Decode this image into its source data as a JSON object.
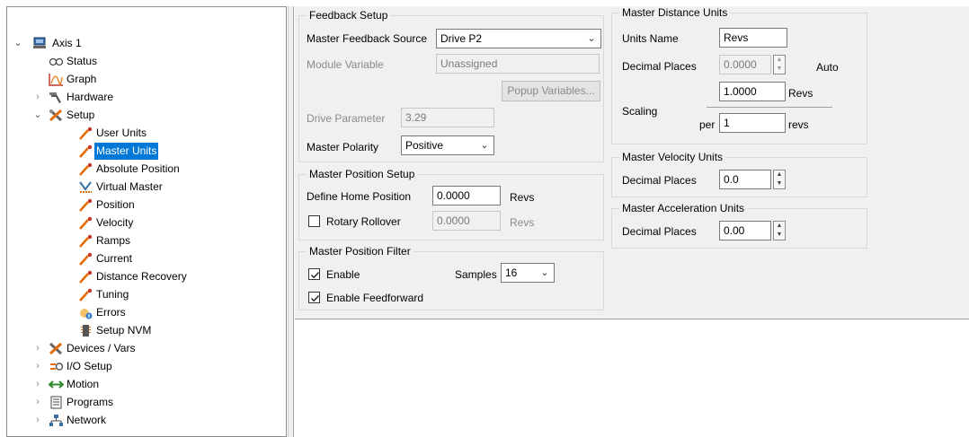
{
  "tree": {
    "items": [
      {
        "label": "Axis 1",
        "icon": "axis-icon",
        "expander": "expanded"
      },
      {
        "label": "Status",
        "icon": "status-icon",
        "expander": "none"
      },
      {
        "label": "Graph",
        "icon": "graph-icon",
        "expander": "none"
      },
      {
        "label": "Hardware",
        "icon": "hardware-icon",
        "expander": "collapsed"
      },
      {
        "label": "Setup",
        "icon": "setup-icon",
        "expander": "expanded"
      },
      {
        "label": "User Units",
        "icon": "pin-icon",
        "expander": "none"
      },
      {
        "label": "Master Units",
        "icon": "pin-icon",
        "expander": "none",
        "selected": true
      },
      {
        "label": "Absolute Position",
        "icon": "pin-icon",
        "expander": "none"
      },
      {
        "label": "Virtual Master",
        "icon": "virtual-master-icon",
        "expander": "none"
      },
      {
        "label": "Position",
        "icon": "pin-icon",
        "expander": "none"
      },
      {
        "label": "Velocity",
        "icon": "pin-icon",
        "expander": "none"
      },
      {
        "label": "Ramps",
        "icon": "pin-icon",
        "expander": "none"
      },
      {
        "label": "Current",
        "icon": "pin-icon",
        "expander": "none"
      },
      {
        "label": "Distance Recovery",
        "icon": "pin-icon",
        "expander": "none"
      },
      {
        "label": "Tuning",
        "icon": "pin-icon",
        "expander": "none"
      },
      {
        "label": "Errors",
        "icon": "errors-icon",
        "expander": "none"
      },
      {
        "label": "Setup NVM",
        "icon": "nvm-icon",
        "expander": "none"
      },
      {
        "label": "Devices / Vars",
        "icon": "devices-icon",
        "expander": "collapsed"
      },
      {
        "label": "I/O Setup",
        "icon": "io-icon",
        "expander": "collapsed"
      },
      {
        "label": "Motion",
        "icon": "motion-icon",
        "expander": "collapsed"
      },
      {
        "label": "Programs",
        "icon": "programs-icon",
        "expander": "collapsed"
      },
      {
        "label": "Network",
        "icon": "network-icon",
        "expander": "collapsed"
      }
    ]
  },
  "feedback": {
    "title": "Feedback Setup",
    "source_label": "Master Feedback Source",
    "source_value": "Drive P2",
    "module_var_label": "Module Variable",
    "module_var_value": "Unassigned",
    "popup_label": "Popup Variables...",
    "drive_param_label": "Drive Parameter",
    "drive_param_value": "3.29",
    "polarity_label": "Master Polarity",
    "polarity_value": "Positive"
  },
  "position_setup": {
    "title": "Master Position Setup",
    "home_label": "Define Home Position",
    "home_value": "0.0000",
    "home_unit": "Revs",
    "rollover_label": "Rotary Rollover",
    "rollover_checked": false,
    "rollover_value": "0.0000",
    "rollover_unit": "Revs"
  },
  "filter": {
    "title": "Master Position Filter",
    "enable_label": "Enable",
    "enable_checked": true,
    "samples_label": "Samples",
    "samples_value": "16",
    "feedforward_label": "Enable Feedforward",
    "feedforward_checked": true
  },
  "distance_units": {
    "title": "Master Distance Units",
    "units_name_label": "Units Name",
    "units_name_value": "Revs",
    "decimal_label": "Decimal Places",
    "decimal_value": "0.0000",
    "auto_label": "Auto",
    "scaling_label": "Scaling",
    "scale_top_value": "1.0000",
    "scale_top_unit": "Revs",
    "per_label": "per",
    "scale_bottom_value": "1",
    "scale_bottom_unit": "revs"
  },
  "velocity_units": {
    "title": "Master Velocity Units",
    "decimal_label": "Decimal Places",
    "decimal_value": "0.0"
  },
  "accel_units": {
    "title": "Master Acceleration Units",
    "decimal_label": "Decimal Places",
    "decimal_value": "0.00"
  }
}
